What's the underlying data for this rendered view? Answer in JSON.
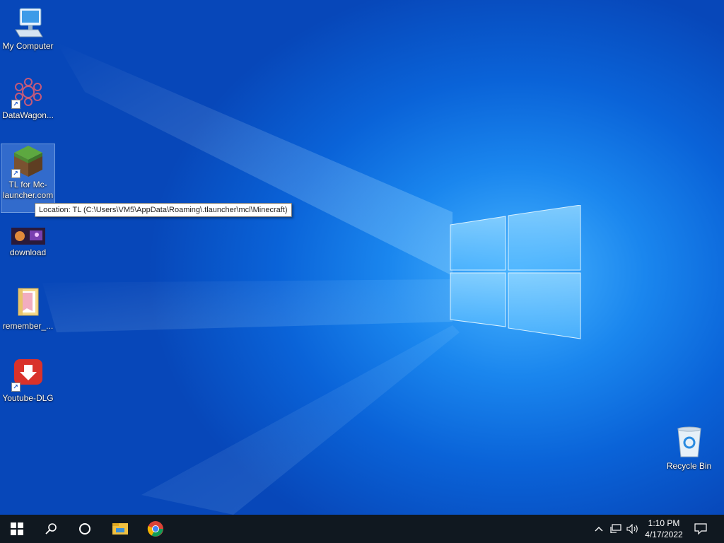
{
  "desktop": {
    "icons": [
      {
        "label": "My Computer",
        "icon": "computer-icon"
      },
      {
        "label": "DataWagon...",
        "icon": "datawagon-icon"
      },
      {
        "label": "TL for Mc-launcher.com",
        "icon": "minecraft-grass-icon"
      },
      {
        "label": "download",
        "icon": "image-thumbnail-icon"
      },
      {
        "label": "remember_...",
        "icon": "folder-icon"
      },
      {
        "label": "Youtube-DLG",
        "icon": "youtube-dlg-icon"
      },
      {
        "label": "Recycle Bin",
        "icon": "recycle-bin-icon"
      }
    ],
    "tooltip": "Location: TL (C:\\Users\\VM5\\AppData\\Roaming\\.tlauncher\\mcl\\Minecraft)"
  },
  "taskbar": {
    "clock_time": "1:10 PM",
    "clock_date": "4/17/2022",
    "buttons": [
      "start-icon",
      "search-icon",
      "cortana-icon",
      "file-explorer-icon",
      "chrome-icon"
    ],
    "tray": [
      "chevron-up-icon",
      "network-icon",
      "speaker-icon",
      "notification-icon"
    ]
  },
  "colors": {
    "taskbar": "#101820",
    "wallpaper_accent": "#1a86ee",
    "tooltip_bg": "#ffffff"
  }
}
